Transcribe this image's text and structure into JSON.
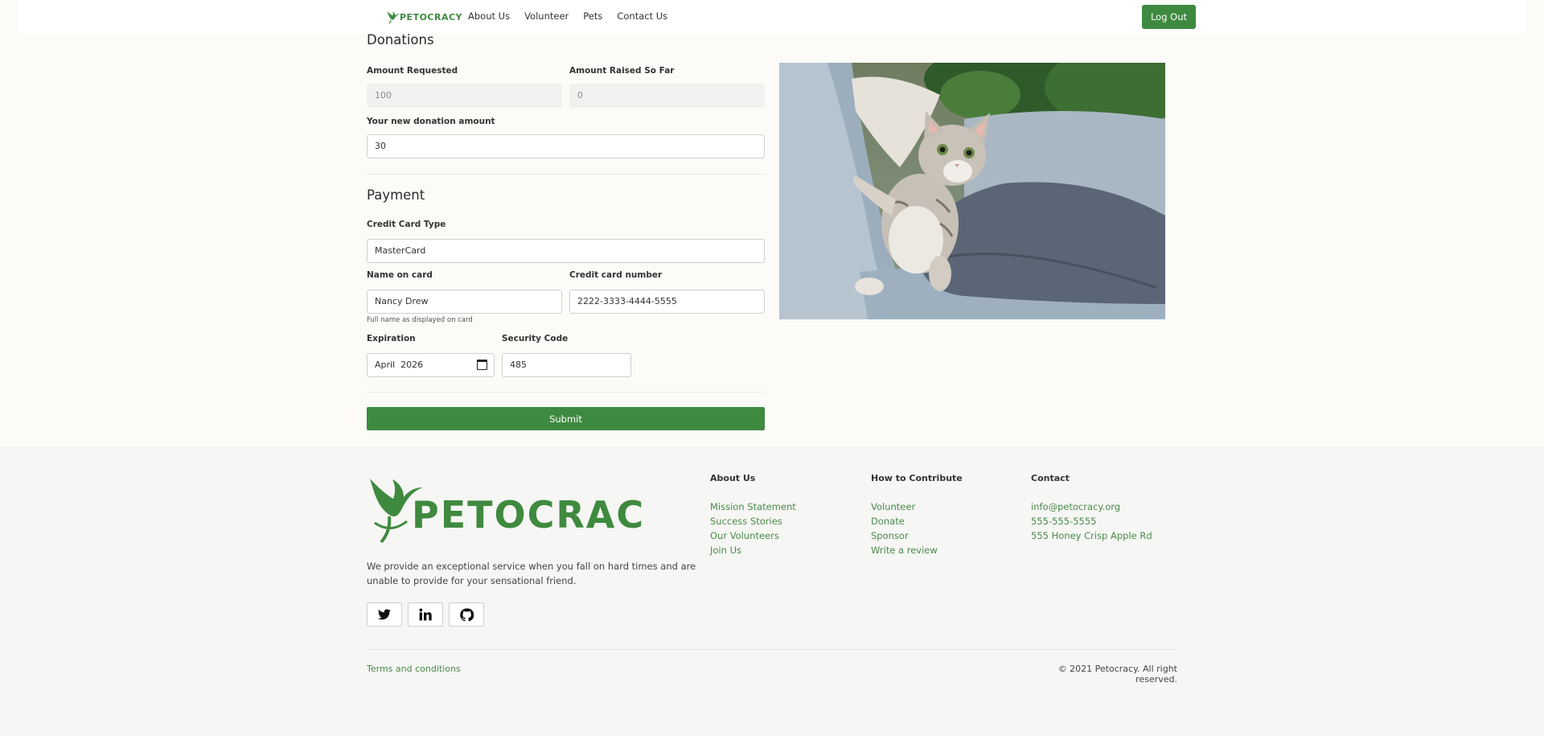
{
  "nav": {
    "brand": "PETOCRACY",
    "links": [
      "About Us",
      "Volunteer",
      "Pets",
      "Contact Us"
    ],
    "logout_label": "Log Out"
  },
  "donations": {
    "heading": "Donations",
    "amount_requested_label": "Amount Requested",
    "amount_requested_value": "100",
    "amount_raised_label": "Amount Raised So Far",
    "amount_raised_value": "0",
    "new_donation_label": "Your new donation amount",
    "new_donation_value": "30"
  },
  "payment": {
    "heading": "Payment",
    "card_type_label": "Credit Card Type",
    "card_type_value": "MasterCard",
    "name_label": "Name on card",
    "name_value": "Nancy Drew",
    "name_hint": "Full name as displayed on card",
    "number_label": "Credit card number",
    "number_value": "2222-3333-4444-5555",
    "expiration_label": "Expiration",
    "expiration_value": "April  2026",
    "security_label": "Security Code",
    "security_value": "485",
    "submit_label": "Submit"
  },
  "footer": {
    "brand": "PETOCRACY",
    "description": "We provide an exceptional service when you fall on hard times and are unable to provide for your sensational friend.",
    "social_icons": [
      "twitter-icon",
      "linkedin-icon",
      "github-icon"
    ],
    "columns": [
      {
        "title": "About Us",
        "links": [
          "Mission Statement",
          "Success Stories",
          "Our Volunteers",
          "Join Us"
        ]
      },
      {
        "title": "How to Contribute",
        "links": [
          "Volunteer",
          "Donate",
          "Sponsor",
          "Write a review"
        ]
      },
      {
        "title": "Contact",
        "links": [
          "info@petocracy.org",
          "555-555-5555",
          "555 Honey Crisp Apple Rd"
        ]
      }
    ],
    "terms": "Terms and conditions",
    "copyright": "© 2021 Petocracy. All right reserved."
  },
  "colors": {
    "accent": "#3e8a40",
    "background": "#fcfbf8",
    "footer_bg": "#f6f6f4"
  }
}
